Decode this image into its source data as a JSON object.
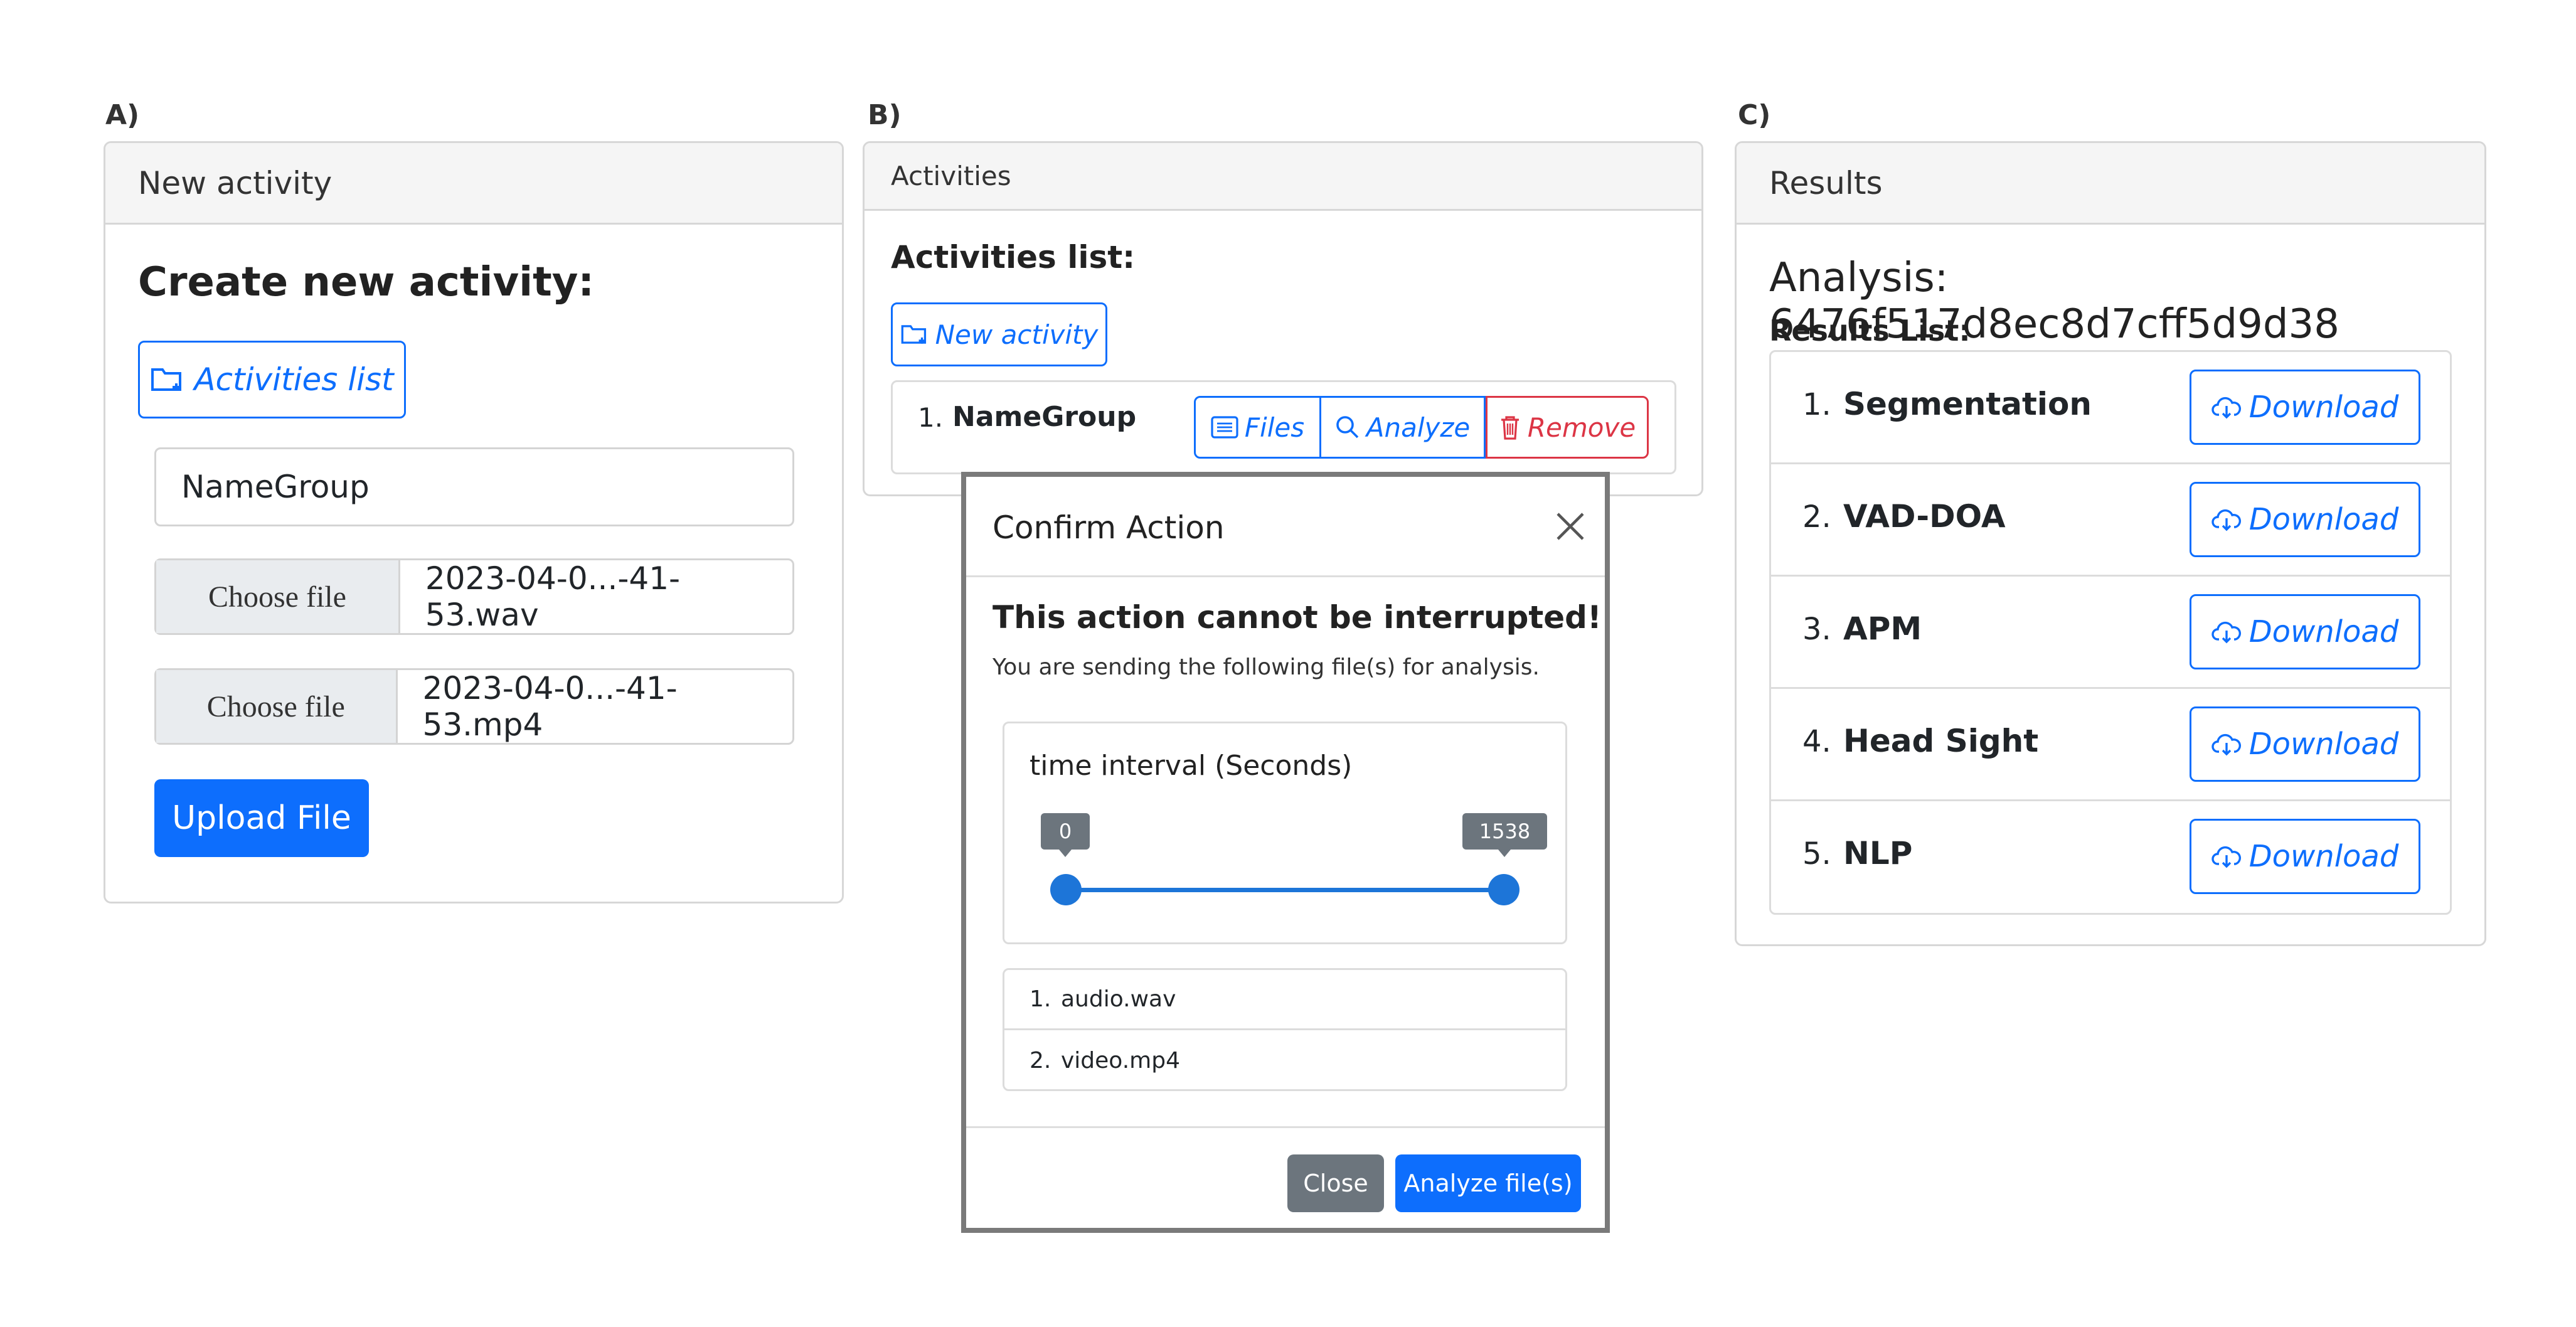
{
  "panel_a": {
    "label": "A)",
    "header": "New activity",
    "heading": "Create new activity:",
    "activities_list_button": "Activities list",
    "name_input_value": "NameGroup",
    "file_inputs": [
      {
        "button": "Choose file",
        "filename": "2023-04-0...-41-53.wav"
      },
      {
        "button": "Choose file",
        "filename": "2023-04-0...-41-53.mp4"
      }
    ],
    "upload_button": "Upload File"
  },
  "panel_b": {
    "label": "B)",
    "header": "Activities",
    "heading": "Activities list:",
    "new_activity_button": "New activity",
    "activity": {
      "index": "1.",
      "name": "NameGroup"
    },
    "files_button": "Files",
    "analyze_button": "Analyze",
    "remove_button": "Remove"
  },
  "modal": {
    "title": "Confirm Action",
    "warning_title": "This action cannot be interrupted!",
    "warning_text": "You are sending the following file(s) for analysis.",
    "interval_label": "time interval (Seconds)",
    "slider": {
      "min_label": "0",
      "max_label": "1538",
      "min_value": 0,
      "max_value": 1538
    },
    "files": [
      {
        "index": "1.",
        "name": "audio.wav"
      },
      {
        "index": "2.",
        "name": "video.mp4"
      }
    ],
    "close_button": "Close",
    "analyze_button": "Analyze file(s)"
  },
  "panel_c": {
    "label": "C)",
    "header": "Results",
    "analysis_title": "Analysis: 6476f517d8ec8d7cff5d9d38",
    "results_label": "Results List:",
    "results": [
      {
        "index": "1.",
        "name": "Segmentation",
        "button": "Download"
      },
      {
        "index": "2.",
        "name": "VAD-DOA",
        "button": "Download"
      },
      {
        "index": "3.",
        "name": "APM",
        "button": "Download"
      },
      {
        "index": "4.",
        "name": "Head Sight",
        "button": "Download"
      },
      {
        "index": "5.",
        "name": "NLP",
        "button": "Download"
      }
    ]
  },
  "colors": {
    "primary": "#0d6efd",
    "danger": "#dc3545",
    "secondary": "#6c757d",
    "header_bg": "#f5f5f5"
  }
}
